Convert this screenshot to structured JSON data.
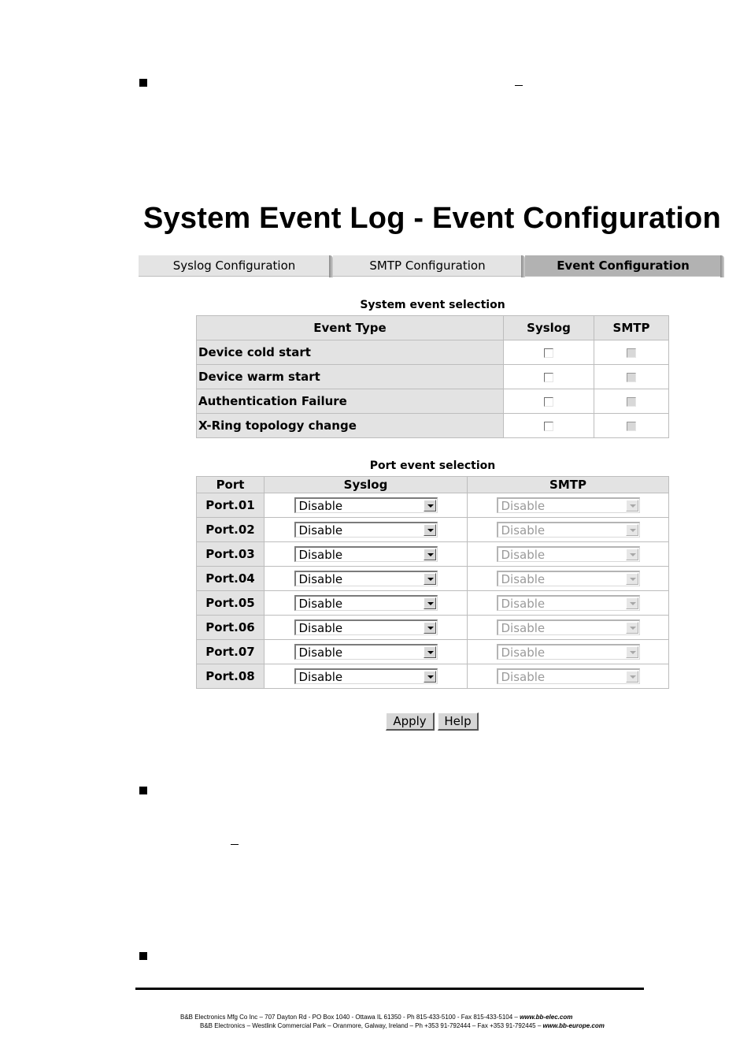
{
  "page_title": "System Event Log - Event Configuration",
  "tabs": [
    {
      "label": "Syslog Configuration",
      "active": false
    },
    {
      "label": "SMTP Configuration",
      "active": false
    },
    {
      "label": "Event Configuration",
      "active": true
    }
  ],
  "system_events": {
    "caption": "System event selection",
    "headers": {
      "event_type": "Event Type",
      "syslog": "Syslog",
      "smtp": "SMTP"
    },
    "rows": [
      {
        "label": "Device cold start",
        "syslog": false,
        "smtp": false
      },
      {
        "label": "Device warm start",
        "syslog": false,
        "smtp": false
      },
      {
        "label": "Authentication Failure",
        "syslog": false,
        "smtp": false
      },
      {
        "label": "X-Ring topology change",
        "syslog": false,
        "smtp": false
      }
    ]
  },
  "port_events": {
    "caption": "Port event selection",
    "headers": {
      "port": "Port",
      "syslog": "Syslog",
      "smtp": "SMTP"
    },
    "rows": [
      {
        "port": "Port.01",
        "syslog": "Disable",
        "smtp": "Disable"
      },
      {
        "port": "Port.02",
        "syslog": "Disable",
        "smtp": "Disable"
      },
      {
        "port": "Port.03",
        "syslog": "Disable",
        "smtp": "Disable"
      },
      {
        "port": "Port.04",
        "syslog": "Disable",
        "smtp": "Disable"
      },
      {
        "port": "Port.05",
        "syslog": "Disable",
        "smtp": "Disable"
      },
      {
        "port": "Port.06",
        "syslog": "Disable",
        "smtp": "Disable"
      },
      {
        "port": "Port.07",
        "syslog": "Disable",
        "smtp": "Disable"
      },
      {
        "port": "Port.08",
        "syslog": "Disable",
        "smtp": "Disable"
      }
    ]
  },
  "buttons": {
    "apply": "Apply",
    "help": "Help"
  },
  "footer": {
    "line1_text": "B&B Electronics Mfg Co Inc – 707 Dayton Rd - PO Box 1040 - Ottawa IL 61350 - Ph 815-433-5100 - Fax 815-433-5104 – ",
    "line1_url": "www.bb-elec.com",
    "line2_text": "B&B Electronics – Westlink Commercial Park – Oranmore, Galway, Ireland – Ph +353 91-792444 – Fax +353 91-792445 – ",
    "line2_url": "www.bb-europe.com"
  }
}
